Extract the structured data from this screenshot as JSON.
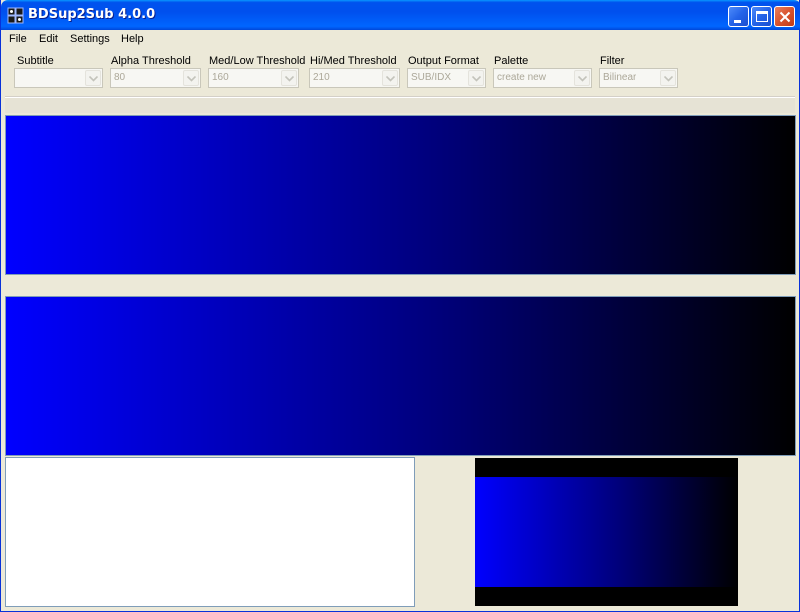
{
  "window": {
    "title": "BDSup2Sub 4.0.0"
  },
  "menu": {
    "items": [
      {
        "label": "File"
      },
      {
        "label": "Edit"
      },
      {
        "label": "Settings"
      },
      {
        "label": "Help"
      }
    ]
  },
  "toolbar": {
    "controls": [
      {
        "label": "Subtitle",
        "value": ""
      },
      {
        "label": "Alpha Threshold",
        "value": "80"
      },
      {
        "label": "Med/Low Threshold",
        "value": "160"
      },
      {
        "label": "Hi/Med Threshold",
        "value": "210"
      },
      {
        "label": "Output Format",
        "value": "SUB/IDX"
      },
      {
        "label": "Palette",
        "value": "create new"
      },
      {
        "label": "Filter",
        "value": "Bilinear"
      }
    ]
  },
  "colors": {
    "preview_start": "#0000ff",
    "preview_end": "#000000",
    "titlebar": "#0054e3"
  },
  "icons": {
    "app": "bdsup2sub-app-icon",
    "minimize": "minimize-icon",
    "maximize": "maximize-icon",
    "close": "close-icon",
    "combo_arrow": "chevron-down-icon"
  }
}
